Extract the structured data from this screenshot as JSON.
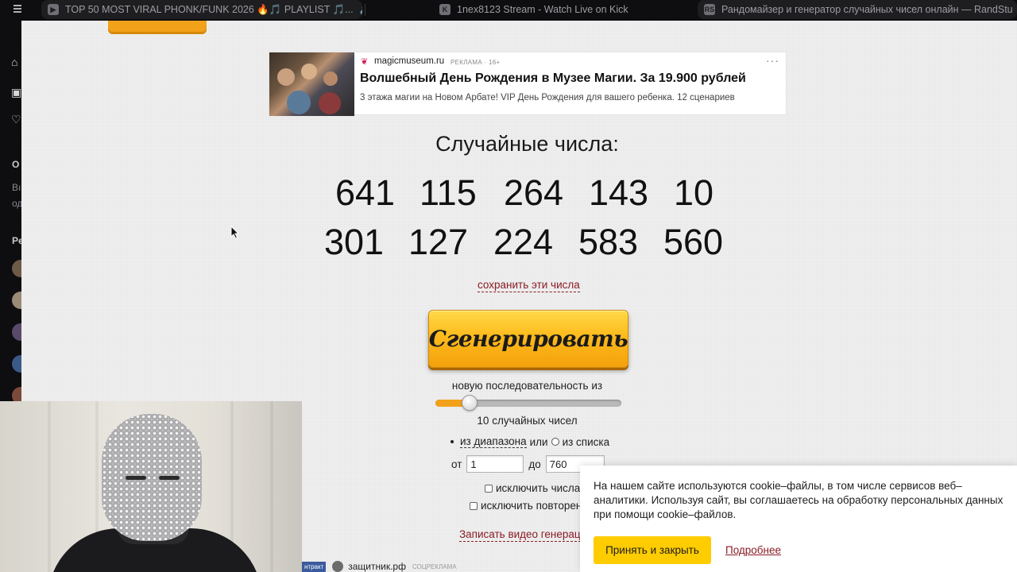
{
  "browser": {
    "tabs": [
      {
        "title": "TOP 50 MOST VIRAL PHONK/FUNK 2026 🔥🎵 PLAYLIST 🎵...",
        "favicon": "youtube-icon",
        "extra": "🔊"
      },
      {
        "title": "1nex8123 Stream - Watch Live on Kick",
        "favicon": "K"
      },
      {
        "title": "Рандомайзер и генератор случайных чисел онлайн — RandStu",
        "favicon": "RS"
      }
    ]
  },
  "ad": {
    "domain": "magicmuseum.ru",
    "mark": "РЕКЛАМА · 16+",
    "title": "Волшебный День Рождения в Музее Магии. За 19.900 рублей",
    "description": "3 этажа магии на Новом Арбате! VIP День Рождения для вашего ребенка. 12 сценариев",
    "more": "···"
  },
  "results": {
    "heading": "Случайные числа:",
    "row1": [
      "641",
      "115",
      "264",
      "143",
      "10"
    ],
    "row2": [
      "301",
      "127",
      "224",
      "583",
      "560"
    ],
    "save_link": "сохранить эти числа"
  },
  "generator": {
    "button_label": "Сгенерировать",
    "sequence_label": "новую последовательность из",
    "count_label": "10 случайных чисел",
    "slider_value": 10,
    "mode_range": "из диапазона",
    "mode_or": "или",
    "mode_list": "из списка",
    "from_label": "от",
    "from_value": "1",
    "to_label": "до",
    "to_value": "760",
    "exclude_numbers": "исключить числа",
    "exclude_repeats": "исключить повторен",
    "record_video": "Записать видео генерац"
  },
  "bottom_ad": {
    "tag": "нтракт",
    "domain": "защитник.рф",
    "mark": "СОЦРЕКЛАМА"
  },
  "cookie": {
    "text": "На нашем сайте используются cookie–файлы, в том числе сервисов веб–аналитики. Используя сайт, вы соглашаетесь на обработку персональных данных при помощи cookie–файлов.",
    "accept_label": "Принять и закрыть",
    "more_label": "Подробнее"
  },
  "sidebar": {
    "text_o": "О",
    "text_b": "Вı",
    "text_od": "од",
    "text_p": "Рє"
  },
  "colors": {
    "accent_orange": "#f2a11a",
    "link_red": "#8a1c24",
    "cookie_yellow": "#ffcc00"
  }
}
